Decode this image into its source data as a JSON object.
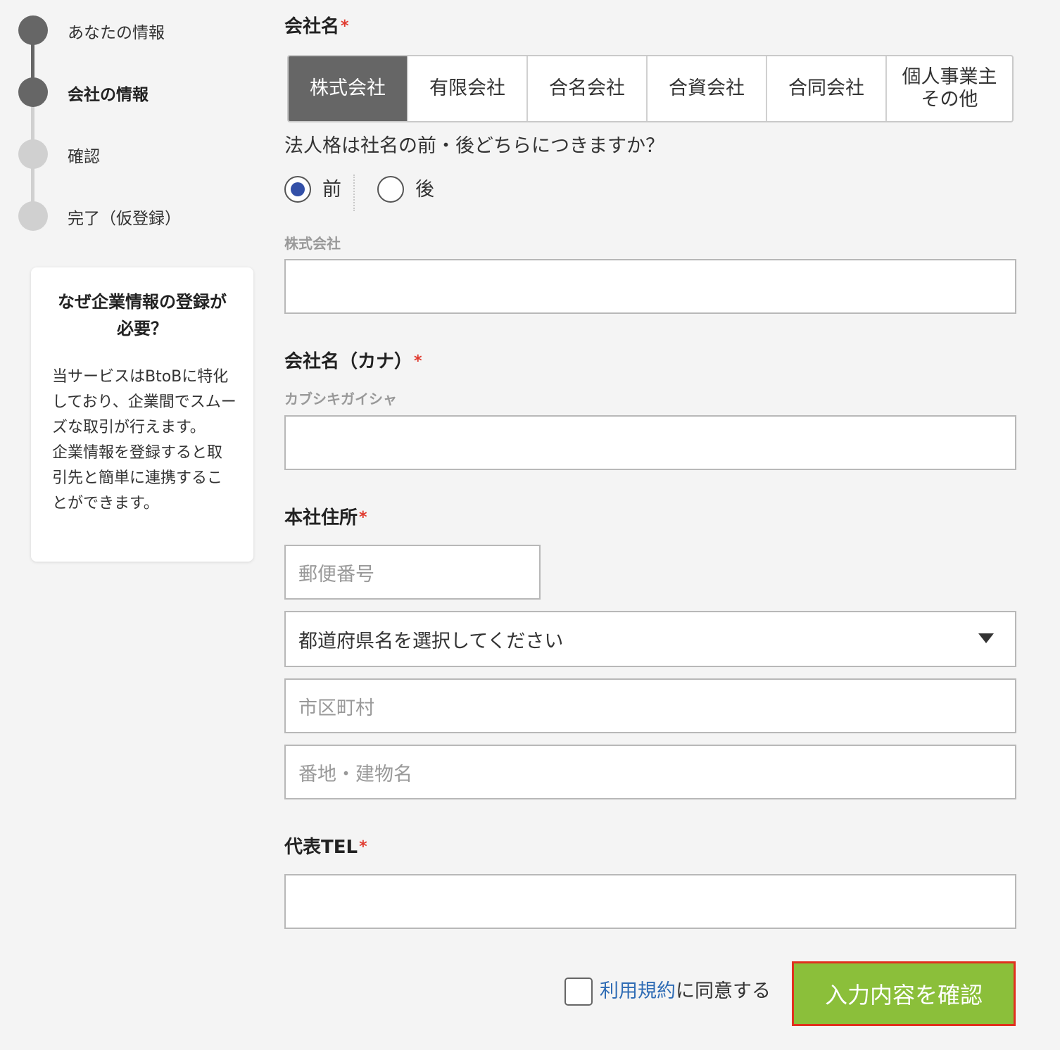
{
  "stepper": {
    "steps": [
      {
        "label": "あなたの情報",
        "state": "done"
      },
      {
        "label": "会社の情報",
        "state": "current"
      },
      {
        "label": "確認",
        "state": "todo"
      },
      {
        "label": "完了（仮登録）",
        "state": "todo"
      }
    ],
    "colors": {
      "done": "#666666",
      "todo": "#d0d0d0"
    }
  },
  "info_card": {
    "title": "なぜ企業情報の登録が必要？",
    "body": "当サービスはBtoBに特化しており、企業間でスムーズな取引が行えます。\n企業情報を登録すると取引先と簡単に連携することができます。"
  },
  "form": {
    "company_name": {
      "label": "会社名",
      "required_mark": "*",
      "entity_types": [
        "株式会社",
        "有限会社",
        "合名会社",
        "合資会社",
        "合同会社",
        "個人事業主\nその他"
      ],
      "selected_entity_type": "株式会社",
      "position_question": "法人格は社名の前・後どちらにつきますか？",
      "position_options": [
        "前",
        "後"
      ],
      "position_selected": "前",
      "input_prefix_label": "株式会社",
      "value": ""
    },
    "company_kana": {
      "label": "会社名（カナ）",
      "required_mark": "*",
      "sublabel": "カブシキガイシャ",
      "value": ""
    },
    "address": {
      "label": "本社住所",
      "required_mark": "*",
      "postal_placeholder": "郵便番号",
      "prefecture_select": "都道府県名を選択してください",
      "city_placeholder": "市区町村",
      "street_placeholder": "番地・建物名"
    },
    "phone": {
      "label": "代表TEL",
      "required_mark": "*",
      "value": ""
    },
    "terms": {
      "link_text": "利用規約",
      "suffix": "に同意する",
      "checked": false
    },
    "submit_label": "入力内容を確認"
  },
  "colors": {
    "accent_green": "#8bbf3a",
    "required_red": "#e03a2f",
    "link_blue": "#2f6cb5",
    "radio_blue": "#3350a8",
    "highlight_red": "#e0301e"
  }
}
